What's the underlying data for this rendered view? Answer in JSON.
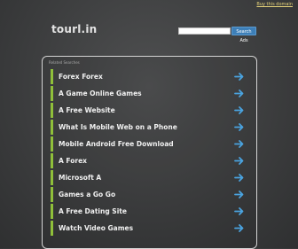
{
  "header": {
    "top_link": "Buy this domain",
    "logo": "tourl.in",
    "search_placeholder": "",
    "search_button": "Search Ads"
  },
  "panel": {
    "caption": "Related Searches",
    "items": [
      {
        "label": "Forex Forex"
      },
      {
        "label": "A Game Online Games"
      },
      {
        "label": "A Free Website"
      },
      {
        "label": "What Is Mobile Web on a Phone"
      },
      {
        "label": "Mobile Android Free Download"
      },
      {
        "label": "A Forex"
      },
      {
        "label": "Microsoft A"
      },
      {
        "label": "Games a Go Go"
      },
      {
        "label": "A Free Dating Site"
      },
      {
        "label": "Watch Video Games"
      }
    ],
    "item_icon": "arrow-right-icon"
  },
  "colors": {
    "accent_bar": "#8fbf3a",
    "arrow": "#4aa3df",
    "button": "#3d7fb8"
  }
}
